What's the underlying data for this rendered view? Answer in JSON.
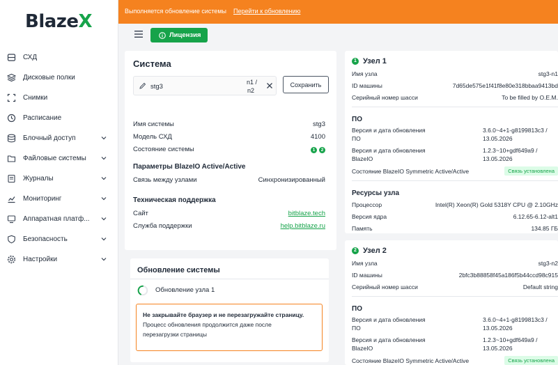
{
  "app": {
    "logo_prefix": "Blaze",
    "logo_accent": "X"
  },
  "colors": {
    "accent": "#16a34a",
    "banner": "#f5821f",
    "warning_border": "#f5821f"
  },
  "sidebar": {
    "items": [
      {
        "label": "СХД",
        "icon": "storage-icon",
        "has_chevron": false
      },
      {
        "label": "Дисковые полки",
        "icon": "layers-icon",
        "has_chevron": false
      },
      {
        "label": "Снимки",
        "icon": "snapshot-icon",
        "has_chevron": false
      },
      {
        "label": "Расписание",
        "icon": "clock-icon",
        "has_chevron": false
      },
      {
        "label": "Блочный доступ",
        "icon": "database-icon",
        "has_chevron": true
      },
      {
        "label": "Файловые системы",
        "icon": "folder-icon",
        "has_chevron": true
      },
      {
        "label": "Журналы",
        "icon": "journal-icon",
        "has_chevron": true
      },
      {
        "label": "Мониторинг",
        "icon": "chart-icon",
        "has_chevron": true
      },
      {
        "label": "Аппаратная платф...",
        "icon": "hardware-icon",
        "has_chevron": true
      },
      {
        "label": "Безопасность",
        "icon": "shield-icon",
        "has_chevron": true
      },
      {
        "label": "Настройки",
        "icon": "gear-icon",
        "has_chevron": true
      }
    ]
  },
  "banner": {
    "text": "Выполняется обновление системы",
    "link": "Перейти к обновлению"
  },
  "toolbar": {
    "license_label": "Лицензия"
  },
  "system": {
    "title": "Система",
    "name_value": "stg3",
    "nodes_top": "n1 /",
    "nodes_bottom": "n2",
    "save_label": "Сохранить",
    "rows": {
      "name_k": "Имя системы",
      "name_v": "stg3",
      "model_k": "Модель СХД",
      "model_v": "4100",
      "state_k": "Состояние системы",
      "state_dot1": "1",
      "state_dot2": "2"
    },
    "params_title": "Параметры BlazeIO Active/Active",
    "link_k": "Связь между узлами",
    "link_v": "Синхронизированный",
    "support_title": "Техническая поддержка",
    "site_k": "Сайт",
    "site_v": "bitblaze.tech",
    "service_k": "Служба поддержки",
    "service_v": "help.bitblaze.ru"
  },
  "update": {
    "title": "Обновление системы",
    "node_text": "Обновление узла 1",
    "warn_line1": "Не закрывайте браузер и не перезагружайте страницу.",
    "warn_line2": "Процесс обновления продолжится даже после",
    "warn_line3": "перезагрузки страницы"
  },
  "labels": {
    "node_name": "Имя узла",
    "machine_id": "ID машины",
    "serial": "Серийный номер шасси",
    "po": "ПО",
    "po_version": "Версия и дата обновления ПО",
    "blazeio_version_1": "Версия и дата обновления",
    "blazeio_version_2": "BlazeIO",
    "blazeio_state": "Состояние BlazeIO Symmetric Active/Active",
    "resources": "Ресурсы узла",
    "cpu": "Процессор",
    "kernel": "Версия ядра",
    "memory": "Память"
  },
  "node1": {
    "title": "Узел 1",
    "dot": "1",
    "name": "stg3-n1",
    "machine_id": "7d65de575e1f41f8e80e318bbaa9413bd",
    "serial": "To be filled by O.E.M.",
    "po_v1": "3.6.0~4+1-g8199813c3 /",
    "po_v2": "13.05.2026",
    "bio_v1": "1.2.3~10+gdf649a9 /",
    "bio_v2": "13.05.2026",
    "state_badge": "Связь установлена",
    "cpu": "Intel(R) Xeon(R) Gold 5318Y CPU @ 2.10GHz",
    "kernel": "6.12.65-6.12-alt1",
    "memory": "134.85 ГБ"
  },
  "node2": {
    "title": "Узел 2",
    "dot": "2",
    "name": "stg3-n2",
    "machine_id": "2bfc3b88858f45a186f5b44ccd98c915",
    "serial": "Default string",
    "po_v1": "3.6.0~4+1-g8199813c3 /",
    "po_v2": "13.05.2026",
    "bio_v1": "1.2.3~10+gdf649a9 /",
    "bio_v2": "13.05.2026",
    "state_badge": "Связь установлена"
  }
}
